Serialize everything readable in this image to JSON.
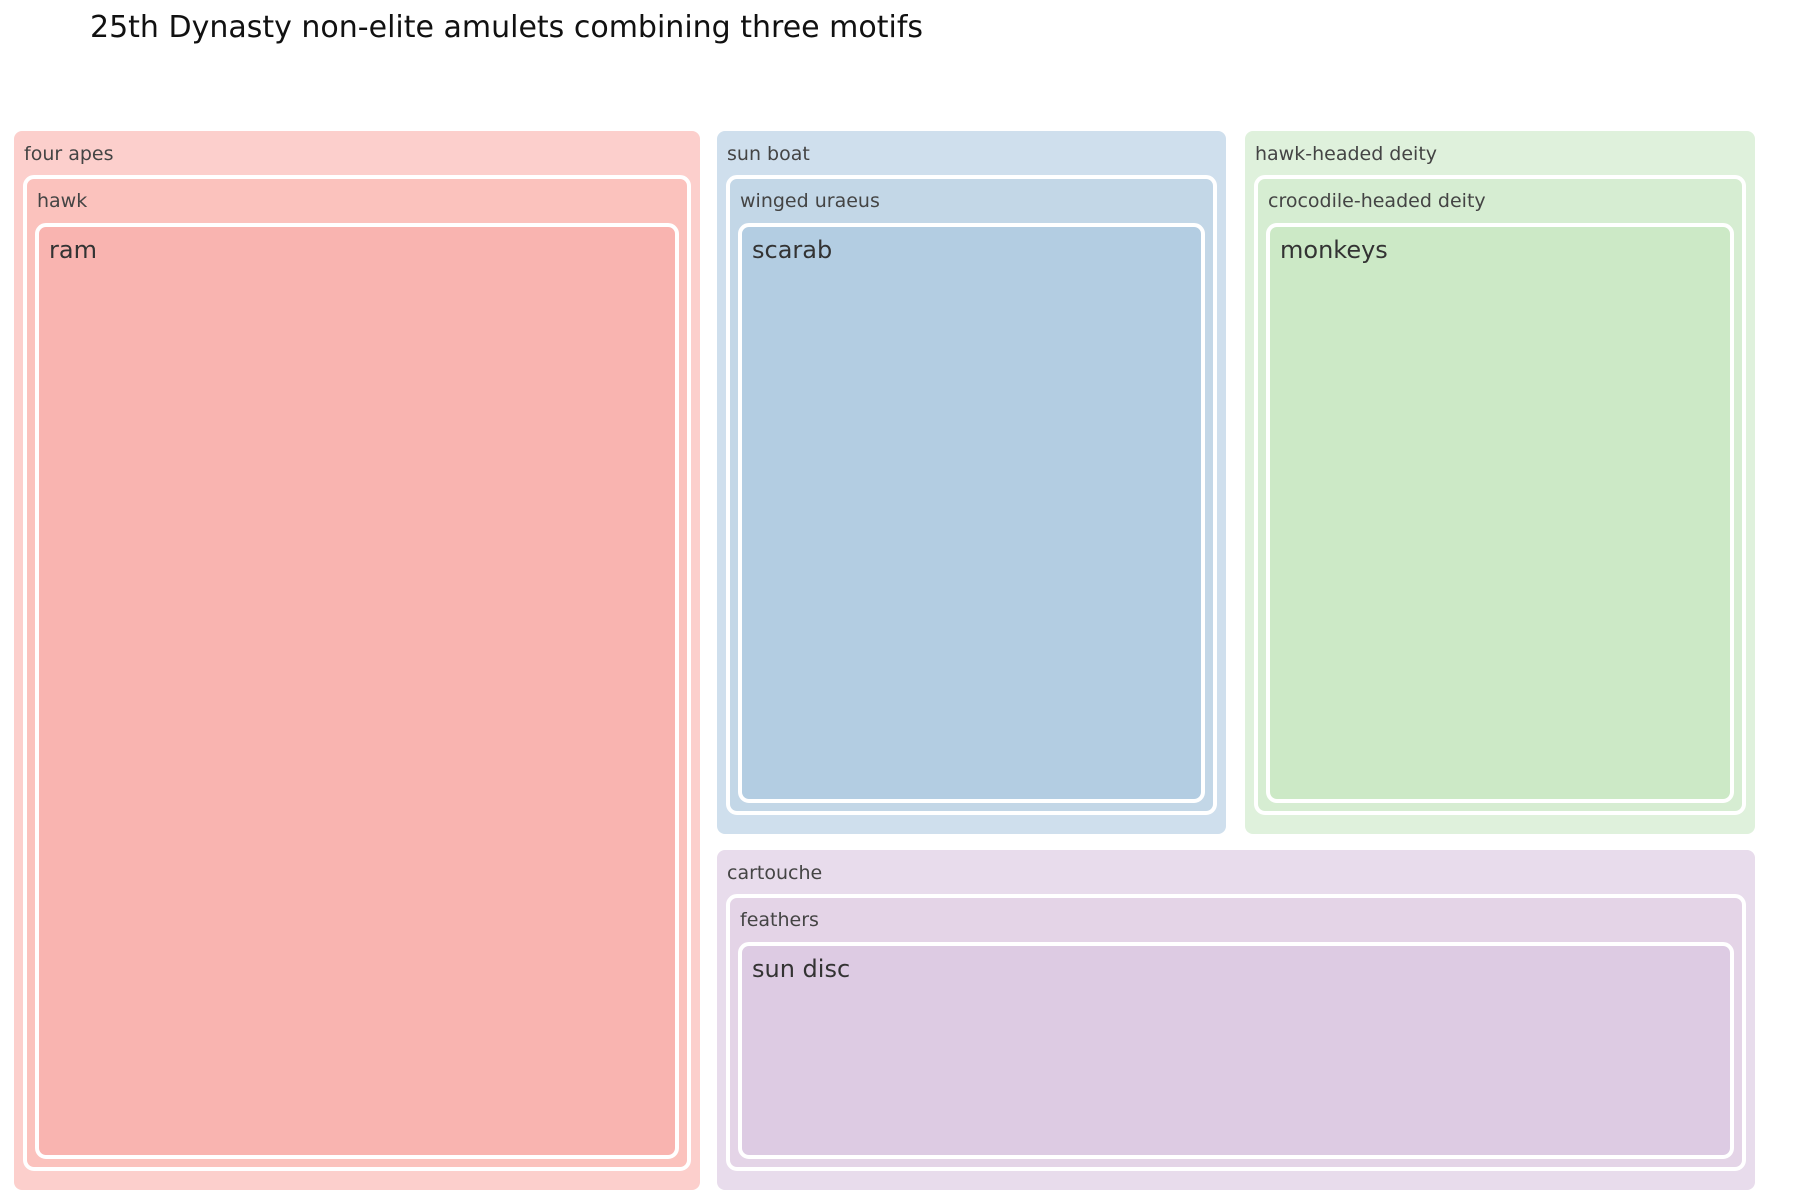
{
  "chart_data": {
    "type": "treemap",
    "title": "25th Dynasty non-elite amulets combining three motifs",
    "groups": [
      {
        "label": "four apes",
        "color": "#fccfcc",
        "child": {
          "label": "hawk",
          "color": "#fbc2bd",
          "child": {
            "label": "ram",
            "color": "#f9b4b0"
          }
        }
      },
      {
        "label": "sun boat",
        "color": "#cfdfed",
        "child": {
          "label": "winged uraeus",
          "color": "#c3d7e7",
          "child": {
            "label": "scarab",
            "color": "#b3cde2"
          }
        }
      },
      {
        "label": "hawk-headed deity",
        "color": "#dff1dc",
        "child": {
          "label": "crocodile-headed deity",
          "color": "#d6edd2",
          "child": {
            "label": "monkeys",
            "color": "#cce9c6"
          }
        }
      },
      {
        "label": "cartouche",
        "color": "#e8dcec",
        "child": {
          "label": "feathers",
          "color": "#e4d4e7",
          "child": {
            "label": "sun disc",
            "color": "#ddcbe3"
          }
        }
      }
    ]
  }
}
